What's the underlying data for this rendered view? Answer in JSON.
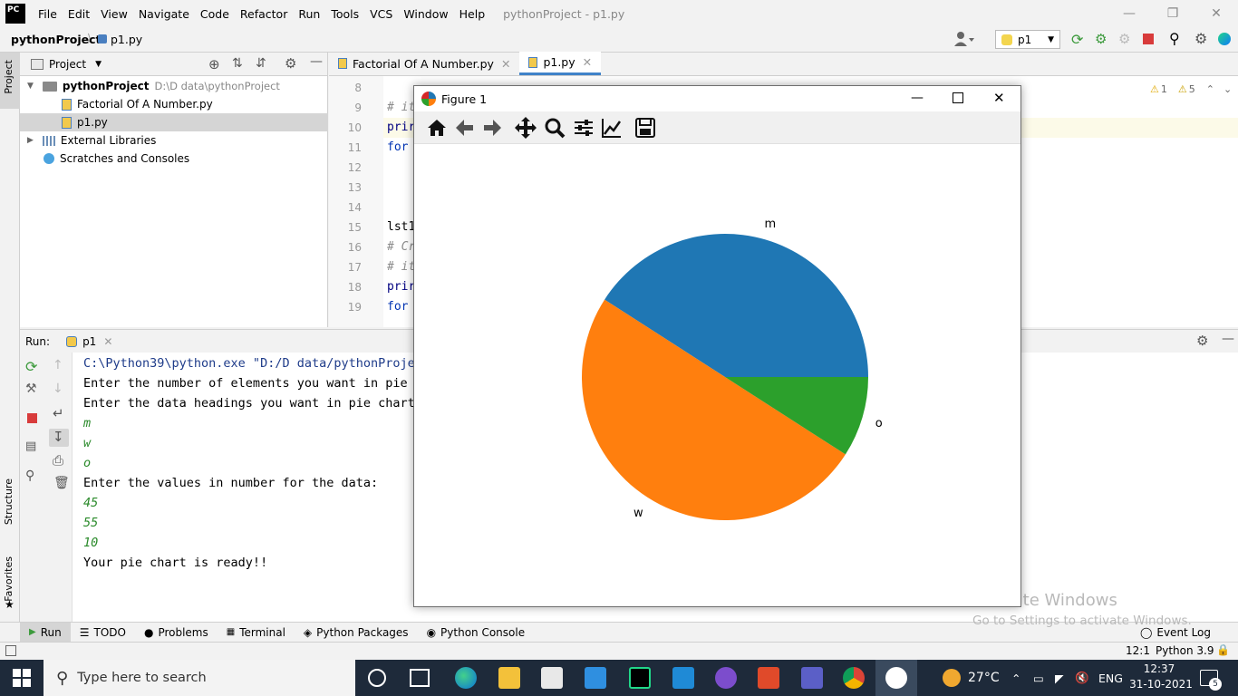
{
  "menubar": {
    "logo": "PC",
    "items": [
      "File",
      "Edit",
      "View",
      "Navigate",
      "Code",
      "Refactor",
      "Run",
      "Tools",
      "VCS",
      "Window",
      "Help"
    ],
    "window_title": "pythonProject - p1.py"
  },
  "navbar": {
    "project": "pythonProject",
    "file": "p1.py",
    "run_config": "p1"
  },
  "project_panel": {
    "title": "Project",
    "tree": [
      {
        "label": "pythonProject",
        "path": "D:\\D data\\pythonProject"
      },
      {
        "label": "Factorial Of A Number.py"
      },
      {
        "label": "p1.py"
      },
      {
        "label": "External Libraries"
      },
      {
        "label": "Scratches and Consoles"
      }
    ]
  },
  "left_strip": {
    "project": "Project",
    "structure": "Structure",
    "favorites": "Favorites"
  },
  "editor": {
    "tabs": [
      "Factorial Of A Number.py",
      "p1.py"
    ],
    "warnings": "1",
    "weak_warnings": "5",
    "lines": [
      {
        "n": "8",
        "text": ""
      },
      {
        "n": "9",
        "text": "# it"
      },
      {
        "n": "10",
        "text": "prir"
      },
      {
        "n": "11",
        "text": "for"
      },
      {
        "n": "12",
        "text": ""
      },
      {
        "n": "13",
        "text": ""
      },
      {
        "n": "14",
        "text": ""
      },
      {
        "n": "15",
        "text": "lst1"
      },
      {
        "n": "16",
        "text": "# Cr"
      },
      {
        "n": "17",
        "text": "# it"
      },
      {
        "n": "18",
        "text": "prir"
      },
      {
        "n": "19",
        "text": "for"
      }
    ]
  },
  "run_panel": {
    "label": "Run:",
    "tab": "p1",
    "output": [
      {
        "text": "C:\\Python39\\python.exe \"D:/D data/pythonProjec",
        "style": "blue"
      },
      {
        "text": "Enter the number of elements you want in pie c",
        "style": "normal"
      },
      {
        "text": "Enter the data headings you want in pie chart:",
        "style": "normal"
      },
      {
        "text": "m",
        "style": "green"
      },
      {
        "text": "w",
        "style": "green"
      },
      {
        "text": "o",
        "style": "green"
      },
      {
        "text": "Enter the values in number for the data:",
        "style": "normal"
      },
      {
        "text": "45",
        "style": "green"
      },
      {
        "text": "55",
        "style": "green"
      },
      {
        "text": "10",
        "style": "green"
      },
      {
        "text": "Your pie chart is ready!!",
        "style": "normal"
      }
    ]
  },
  "tool_windows": [
    "Run",
    "TODO",
    "Problems",
    "Terminal",
    "Python Packages",
    "Python Console"
  ],
  "event_log": "Event Log",
  "statusbar": {
    "position": "12:1",
    "interpreter": "Python 3.9"
  },
  "watermark": {
    "line1": "Activate Windows",
    "line2": "Go to Settings to activate Windows."
  },
  "taskbar": {
    "search_placeholder": "Type here to search",
    "temperature": "27°C",
    "language": "ENG",
    "time": "12:37",
    "date": "31-10-2021",
    "notifications": "5"
  },
  "figure": {
    "title": "Figure 1",
    "tools": [
      "home-icon",
      "back-icon",
      "forward-icon",
      "pan-icon",
      "zoom-icon",
      "configure-subplots-icon",
      "edit-curve-icon",
      "save-icon"
    ]
  },
  "chart_data": {
    "type": "pie",
    "categories": [
      "m",
      "w",
      "o"
    ],
    "values": [
      45,
      55,
      10
    ],
    "colors": [
      "#1f77b4",
      "#ff7f0e",
      "#2ca02c"
    ],
    "start_angle_deg": 0,
    "direction": "counterclockwise",
    "title": "",
    "legend": "none"
  }
}
